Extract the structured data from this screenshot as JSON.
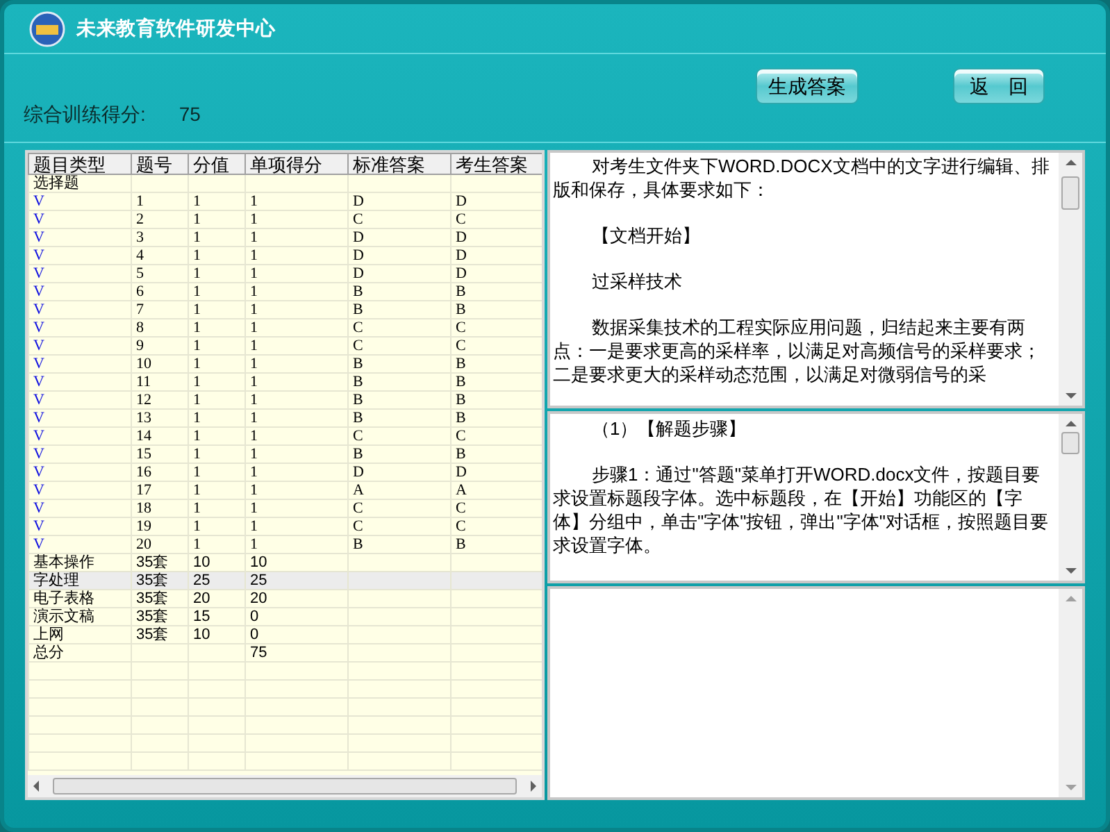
{
  "window": {
    "title": "未来教育软件研发中心"
  },
  "score": {
    "label": "综合训练得分:",
    "value": "75"
  },
  "buttons": [
    "生成答案",
    "返　回"
  ],
  "table": {
    "columns": [
      "题目类型",
      "题号",
      "分值",
      "单项得分",
      "标准答案",
      "考生答案"
    ],
    "rows": [
      {
        "kind": "section",
        "selected": false,
        "cells": [
          "选择题",
          "",
          "",
          "",
          "",
          ""
        ]
      },
      {
        "kind": "question",
        "selected": false,
        "cells": [
          "V",
          "1",
          "1",
          "1",
          "D",
          "D"
        ]
      },
      {
        "kind": "question",
        "selected": false,
        "cells": [
          "V",
          "2",
          "1",
          "1",
          "C",
          "C"
        ]
      },
      {
        "kind": "question",
        "selected": false,
        "cells": [
          "V",
          "3",
          "1",
          "1",
          "D",
          "D"
        ]
      },
      {
        "kind": "question",
        "selected": false,
        "cells": [
          "V",
          "4",
          "1",
          "1",
          "D",
          "D"
        ]
      },
      {
        "kind": "question",
        "selected": false,
        "cells": [
          "V",
          "5",
          "1",
          "1",
          "D",
          "D"
        ]
      },
      {
        "kind": "question",
        "selected": false,
        "cells": [
          "V",
          "6",
          "1",
          "1",
          "B",
          "B"
        ]
      },
      {
        "kind": "question",
        "selected": false,
        "cells": [
          "V",
          "7",
          "1",
          "1",
          "B",
          "B"
        ]
      },
      {
        "kind": "question",
        "selected": false,
        "cells": [
          "V",
          "8",
          "1",
          "1",
          "C",
          "C"
        ]
      },
      {
        "kind": "question",
        "selected": false,
        "cells": [
          "V",
          "9",
          "1",
          "1",
          "C",
          "C"
        ]
      },
      {
        "kind": "question",
        "selected": false,
        "cells": [
          "V",
          "10",
          "1",
          "1",
          "B",
          "B"
        ]
      },
      {
        "kind": "question",
        "selected": false,
        "cells": [
          "V",
          "11",
          "1",
          "1",
          "B",
          "B"
        ]
      },
      {
        "kind": "question",
        "selected": false,
        "cells": [
          "V",
          "12",
          "1",
          "1",
          "B",
          "B"
        ]
      },
      {
        "kind": "question",
        "selected": false,
        "cells": [
          "V",
          "13",
          "1",
          "1",
          "B",
          "B"
        ]
      },
      {
        "kind": "question",
        "selected": false,
        "cells": [
          "V",
          "14",
          "1",
          "1",
          "C",
          "C"
        ]
      },
      {
        "kind": "question",
        "selected": false,
        "cells": [
          "V",
          "15",
          "1",
          "1",
          "B",
          "B"
        ]
      },
      {
        "kind": "question",
        "selected": false,
        "cells": [
          "V",
          "16",
          "1",
          "1",
          "D",
          "D"
        ]
      },
      {
        "kind": "question",
        "selected": false,
        "cells": [
          "V",
          "17",
          "1",
          "1",
          "A",
          "A"
        ]
      },
      {
        "kind": "question",
        "selected": false,
        "cells": [
          "V",
          "18",
          "1",
          "1",
          "C",
          "C"
        ]
      },
      {
        "kind": "question",
        "selected": false,
        "cells": [
          "V",
          "19",
          "1",
          "1",
          "C",
          "C"
        ]
      },
      {
        "kind": "question",
        "selected": false,
        "cells": [
          "V",
          "20",
          "1",
          "1",
          "B",
          "B"
        ]
      },
      {
        "kind": "section",
        "selected": false,
        "cells": [
          "基本操作",
          "35套",
          "10",
          "10",
          "",
          ""
        ]
      },
      {
        "kind": "section",
        "selected": true,
        "cells": [
          "字处理",
          "35套",
          "25",
          "25",
          "",
          ""
        ]
      },
      {
        "kind": "section",
        "selected": false,
        "cells": [
          "电子表格",
          "35套",
          "20",
          "20",
          "",
          ""
        ]
      },
      {
        "kind": "section",
        "selected": false,
        "cells": [
          "演示文稿",
          "35套",
          "15",
          "0",
          "",
          ""
        ]
      },
      {
        "kind": "section",
        "selected": false,
        "cells": [
          "上网",
          "35套",
          "10",
          "0",
          "",
          ""
        ]
      },
      {
        "kind": "section",
        "selected": false,
        "cells": [
          "总分",
          "",
          "",
          "75",
          "",
          ""
        ]
      }
    ]
  },
  "question_text": [
    "对考生文件夹下WORD.DOCX文档中的文字进行编辑、排版和保存，具体要求如下：",
    "【文档开始】",
    "过采样技术",
    "数据采集技术的工程实际应用问题，归结起来主要有两点：一是要求更高的采样率，以满足对高频信号的采样要求；二是要求更大的采样动态范围，以满足对微弱信号的采"
  ],
  "solution_text": [
    "（1）【解题步骤】",
    "步骤1：通过\"答题\"菜单打开WORD.docx文件，按题目要求设置标题段字体。选中标题段，在【开始】功能区的【字体】分组中，单击\"字体\"按钮，弹出\"字体\"对话框，按照题目要求设置字体。"
  ]
}
